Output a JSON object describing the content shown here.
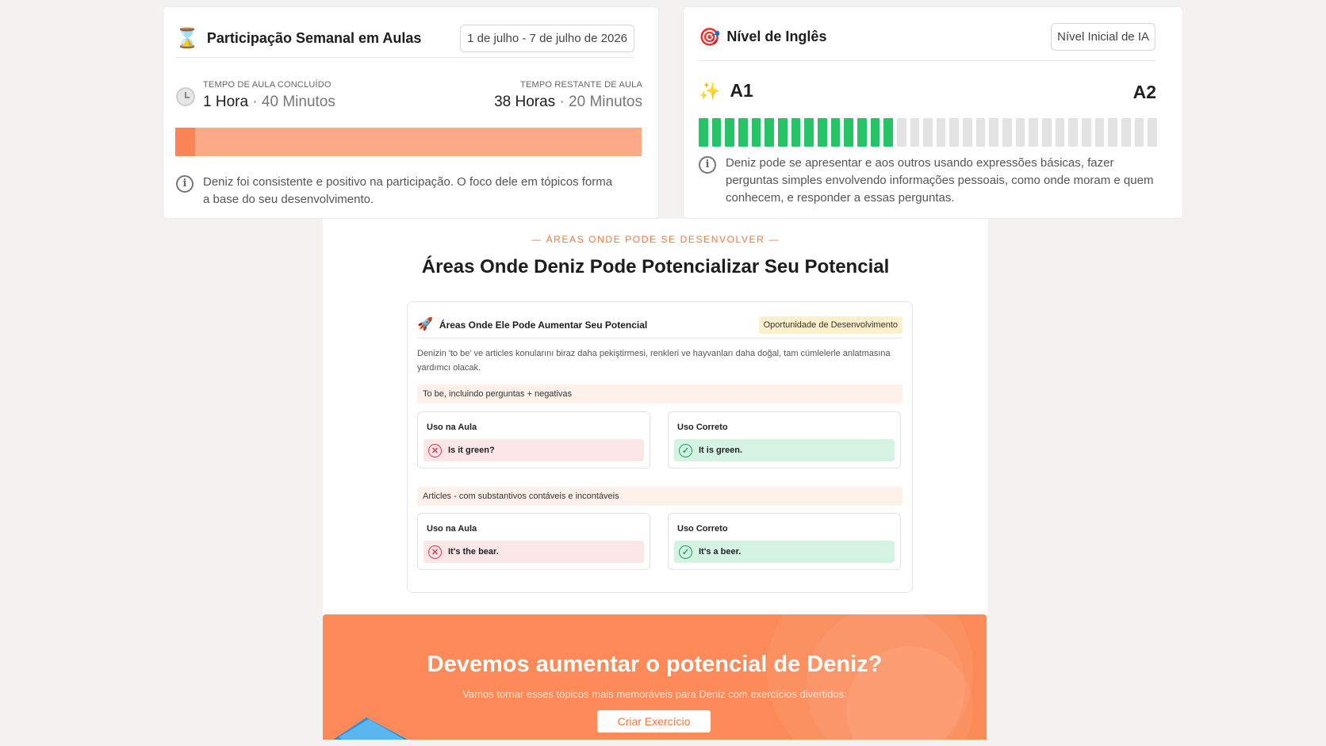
{
  "participation": {
    "icon": "hourglass-icon",
    "title": "Participação Semanal em Aulas",
    "date_range": "1 de julho - 7 de julho de 2026",
    "completed_label": "TEMPO DE AULA CONCLUÍDO",
    "completed_hours": "1 Hora",
    "completed_minutes": "· 40 Minutos",
    "remaining_label": "TEMPO RESTANTE DE AULA",
    "remaining_hours": "38 Horas",
    "remaining_minutes": "· 20 Minutos",
    "progress_fraction": 0.042,
    "info": "Deniz foi consistente e positivo na participação. O foco dele em tópicos forma a base do seu desenvolvimento."
  },
  "english": {
    "icon": "target-icon",
    "title": "Nível de Inglês",
    "badge": "Nível Inicial de IA",
    "level_from": "A1",
    "level_to": "A2",
    "segments_total": 35,
    "segments_filled": 15,
    "info": "Deniz pode se apresentar e aos outros usando expressões básicas, fazer perguntas simples envolvendo informações pessoais, como onde moram e quem conhecem, e responder a essas perguntas."
  },
  "development": {
    "kicker": "—  ÁREAS ONDE PODE SE DESENVOLVER  —",
    "title": "Áreas Onde Deniz Pode Potencializar Seu Potencial",
    "card_title": "Áreas Onde Ele Pode Aumentar Seu Potencial",
    "card_badge": "Oportunidade de Desenvolvimento",
    "description": "Denizin 'to be' ve articles konularını biraz daha pekiştirmesi, renkleri ve hayvanları daha doğal, tam cümlelerle anlatmasına yardımcı olacak.",
    "topics": [
      {
        "name": "To be, incluindo perguntas + negativas",
        "wrong_label": "Uso na Aula",
        "wrong": "Is it green?",
        "right_label": "Uso Correto",
        "right": "It is green."
      },
      {
        "name": "Articles - com substantivos contáveis e incontáveis",
        "wrong_label": "Uso na Aula",
        "wrong": "It's the bear.",
        "right_label": "Uso Correto",
        "right": "It's a beer."
      }
    ]
  },
  "cta": {
    "title": "Devemos aumentar o potencial de Deniz?",
    "subtitle": "Vamos tornar esses tópicos mais memoráveis para Deniz com exercícios divertidos.",
    "button": "Criar Exercício"
  },
  "colors": {
    "accent": "#fb8a58",
    "progress_fill": "#fb8554",
    "progress_track": "#fca987",
    "level_on": "#26c466",
    "level_off": "#e3e3e3"
  }
}
